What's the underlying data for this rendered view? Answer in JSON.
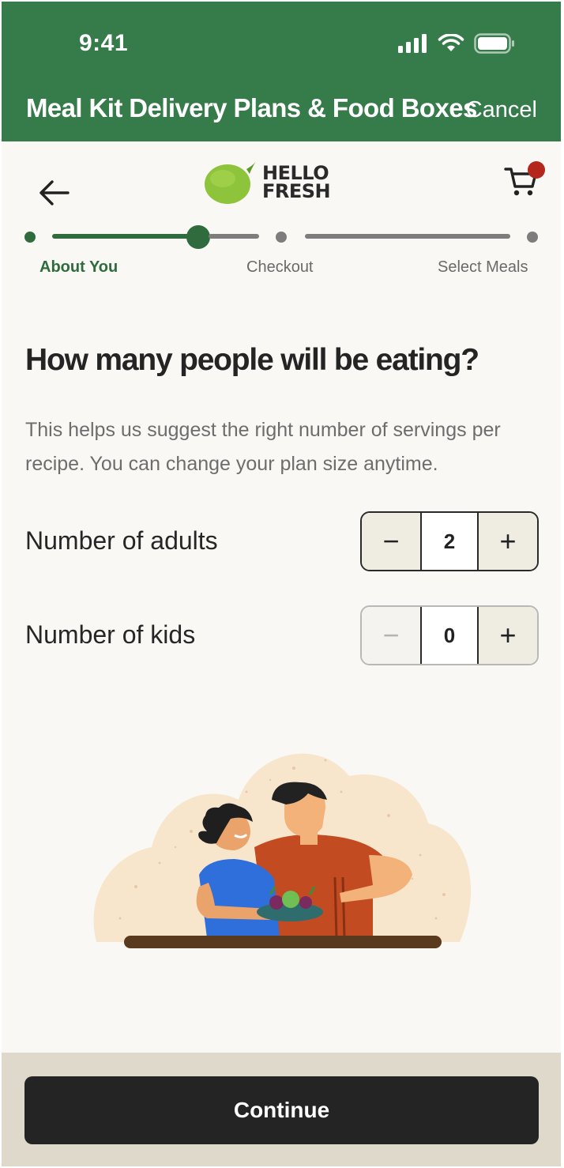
{
  "status_bar": {
    "time": "9:41"
  },
  "header": {
    "title": "Meal Kit Delivery Plans & Food Boxes",
    "cancel_label": "Cancel"
  },
  "brand": {
    "line1": "HELLO",
    "line2": "FRESH"
  },
  "progress": {
    "steps": [
      {
        "label": "About You",
        "state": "current"
      },
      {
        "label": "Checkout",
        "state": "upcoming"
      },
      {
        "label": "Select Meals",
        "state": "upcoming"
      }
    ]
  },
  "question": {
    "title": "How many people will be eating?",
    "helper": "This helps us suggest the right number of servings per recipe. You can change your plan size anytime."
  },
  "adults": {
    "label": "Number of adults",
    "value": "2",
    "minus": "−",
    "plus": "+"
  },
  "kids": {
    "label": "Number of kids",
    "value": "0",
    "minus": "−",
    "plus": "+"
  },
  "footer": {
    "continue_label": "Continue"
  },
  "colors": {
    "brand_green": "#367b4a",
    "accent_dark": "#242424",
    "cart_badge": "#b3271c",
    "footer_bg": "#dfd9cc"
  }
}
